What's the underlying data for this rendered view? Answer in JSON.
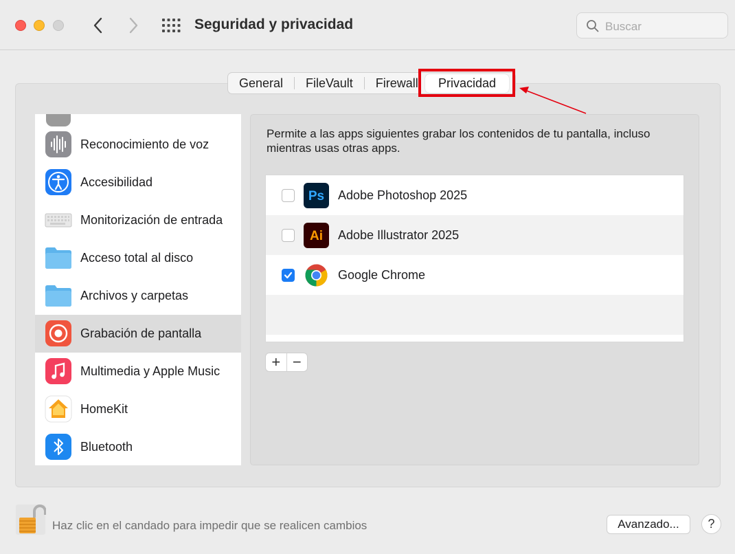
{
  "window": {
    "title": "Seguridad y privacidad",
    "search_placeholder": "Buscar"
  },
  "tabs": [
    {
      "label": "General"
    },
    {
      "label": "FileVault"
    },
    {
      "label": "Firewall"
    },
    {
      "label": "Privacidad",
      "active": true
    }
  ],
  "sidebar": {
    "items": [
      {
        "label": "Reconocimiento de voz",
        "icon": "waveform-icon"
      },
      {
        "label": "Accesibilidad",
        "icon": "accessibility-icon"
      },
      {
        "label": "Monitorización de entrada",
        "icon": "keyboard-icon"
      },
      {
        "label": "Acceso total al disco",
        "icon": "folder-icon"
      },
      {
        "label": "Archivos y carpetas",
        "icon": "folder-icon"
      },
      {
        "label": "Grabación de pantalla",
        "icon": "screen-record-icon",
        "selected": true
      },
      {
        "label": "Multimedia y Apple Music",
        "icon": "music-icon"
      },
      {
        "label": "HomeKit",
        "icon": "home-icon"
      },
      {
        "label": "Bluetooth",
        "icon": "bluetooth-icon"
      }
    ]
  },
  "content": {
    "description": "Permite a las apps siguientes grabar los contenidos de tu pantalla, incluso mientras usas otras apps.",
    "apps": [
      {
        "name": "Adobe Photoshop 2025",
        "checked": false,
        "icon": "photoshop-icon",
        "icon_text": "Ps"
      },
      {
        "name": "Adobe Illustrator 2025",
        "checked": false,
        "icon": "illustrator-icon",
        "icon_text": "Ai"
      },
      {
        "name": "Google Chrome",
        "checked": true,
        "icon": "chrome-icon"
      }
    ],
    "add_label": "+",
    "remove_label": "−"
  },
  "footer": {
    "lock_text": "Haz clic en el candado para impedir que se realicen cambios",
    "advanced_label": "Avanzado...",
    "help_label": "?"
  },
  "colors": {
    "accent": "#1a7cf5",
    "annotation": "#e4000f"
  }
}
